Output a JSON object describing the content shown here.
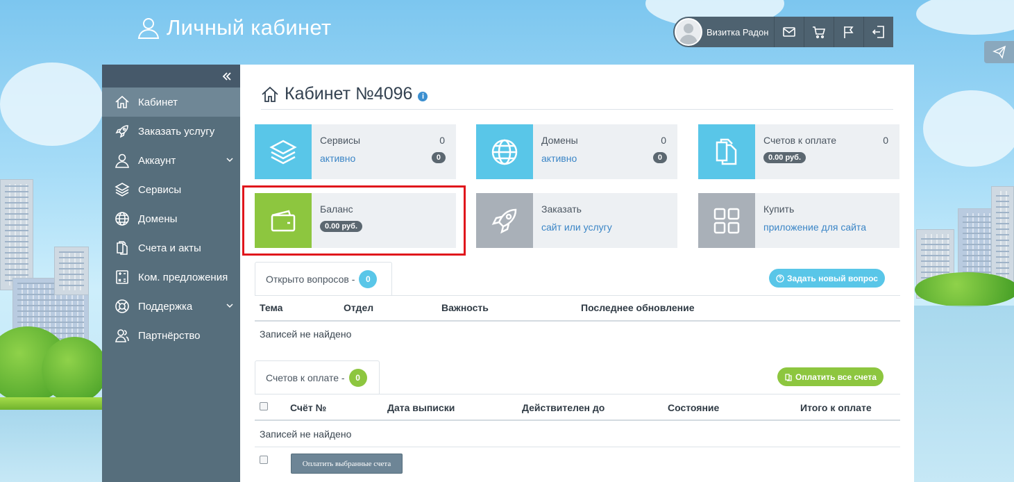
{
  "header": {
    "brand_title": "Личный кабинет",
    "user_name": "Визитка Радон",
    "icons": [
      "user-icon",
      "mail-icon",
      "cart-icon",
      "flag-icon",
      "logout-icon",
      "send-icon"
    ]
  },
  "sidebar": {
    "items": [
      {
        "label": "Кабинет",
        "icon": "home-icon",
        "active": true
      },
      {
        "label": "Заказать услугу",
        "icon": "rocket-icon"
      },
      {
        "label": "Аккаунт",
        "icon": "user-icon",
        "has_submenu": true
      },
      {
        "label": "Сервисы",
        "icon": "layers-icon"
      },
      {
        "label": "Домены",
        "icon": "globe-icon"
      },
      {
        "label": "Счета и акты",
        "icon": "documents-icon"
      },
      {
        "label": "Ком. предложения",
        "icon": "calculator-icon"
      },
      {
        "label": "Поддержка",
        "icon": "lifebuoy-icon",
        "has_submenu": true
      },
      {
        "label": "Партнёрство",
        "icon": "partners-icon"
      }
    ]
  },
  "page": {
    "title": "Кабинет №4096",
    "info": "i"
  },
  "tiles": {
    "services": {
      "label": "Сервисы",
      "count": "0",
      "link": "активно",
      "badge": "0"
    },
    "domains": {
      "label": "Домены",
      "count": "0",
      "link": "активно",
      "badge": "0"
    },
    "invoices": {
      "label": "Счетов к оплате",
      "count": "0",
      "badge": "0.00 руб."
    },
    "balance": {
      "label": "Баланс",
      "badge": "0.00 руб."
    },
    "order": {
      "label": "Заказать",
      "link": "сайт или услугу"
    },
    "buy": {
      "label": "Купить",
      "link": "приложение для сайта"
    }
  },
  "tickets": {
    "tab_label": "Открыто вопросов -",
    "count": "0",
    "new_button": "Задать новый вопрос",
    "columns": [
      "Тема",
      "Отдел",
      "Важность",
      "Последнее обновление"
    ],
    "empty": "Записей не найдено"
  },
  "bills": {
    "tab_label": "Счетов к оплате -",
    "count": "0",
    "pay_all_button": "Оплатить все счета",
    "columns": [
      "Счёт №",
      "Дата выписки",
      "Действителен до",
      "Состояние",
      "Итого к оплате"
    ],
    "empty": "Записей не найдено",
    "pay_selected_button": "Оплатить выбранные счета"
  },
  "colors": {
    "sidebar": "#566e7c",
    "accent_cyan": "#59c6e8",
    "accent_green": "#8dc63f",
    "tile_grey": "#a9b0b8",
    "highlight_red": "#e0161c"
  }
}
